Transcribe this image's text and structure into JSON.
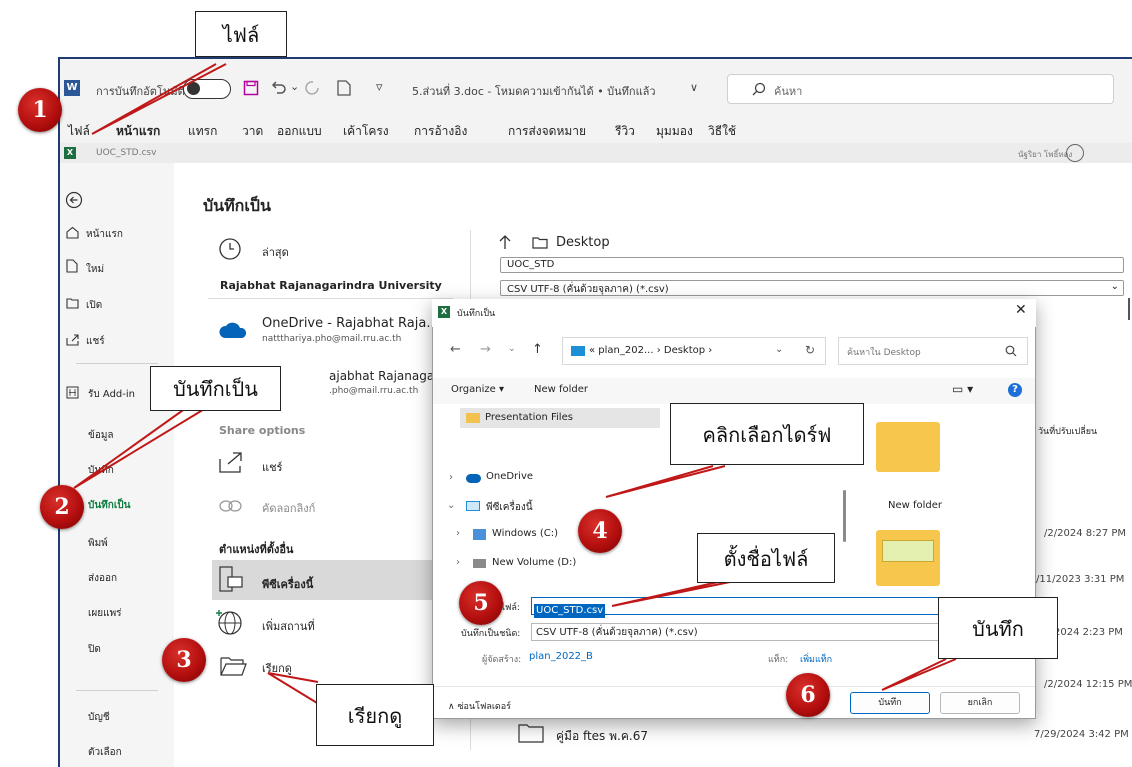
{
  "word": {
    "app_icon": "W",
    "autosave_label": "การบันทึกอัตโนมัติ",
    "doc_title": "5.ส่วนที่ 3.doc - โหมดความเข้ากันได้ • บันทึกแล้ว",
    "title_chevron": "∨",
    "undo_chevron": "⌄",
    "qat_more": "▿",
    "search_placeholder": "ค้นหา",
    "ribbon_tabs": [
      "ไฟล์",
      "หน้าแรก",
      "แทรก",
      "วาด",
      "ออกแบบ",
      "เค้าโครง",
      "การอ้างอิง",
      "การส่งจดหมาย",
      "รีวิว",
      "มุมมอง",
      "วิธีใช้"
    ]
  },
  "excel": {
    "icon": "X",
    "filename": "UOC_STD.csv",
    "user_name": "นัฐริยา โพธิ์ทอง"
  },
  "nav": {
    "items": [
      "หน้าแรก",
      "ใหม่",
      "เปิด",
      "แชร์",
      "รับ Add-in",
      "ข้อมูล",
      "บันทึก",
      "บันทึกเป็น",
      "พิมพ์",
      "ส่งออก",
      "เผยแพร่",
      "ปิด",
      "บัญชี",
      "ตัวเลือก"
    ]
  },
  "backstage": {
    "title": "บันทึกเป็น",
    "recent": "ล่าสุด",
    "university": "Rajabhat Rajanagarindra University",
    "onedrive_name": "OneDrive - Rajabhat Raja...",
    "onedrive_email": "nattthariya.pho@mail.rru.ac.th",
    "site_name": "ajabhat Rajanagar...",
    "site_email": ".pho@mail.rru.ac.th",
    "share_options": "Share options",
    "share": "แชร์",
    "copy_link": "คัดลอกลิงก์",
    "other_locations": "ตำแหน่งที่ตั้งอื่น",
    "this_pc": "พีซีเครื่องนี้",
    "add_place": "เพิ่มสถานที่",
    "browse": "เรียกดู",
    "breadcrumb": "Desktop",
    "name_field": "UOC_STD",
    "type_field": "CSV UTF-8 (คั่นด้วยจุลภาค) (*.csv)",
    "col_modified": "วันที่ปรับเปลี่ยน",
    "dates": [
      "/2/2024 8:27 PM",
      "/11/2023 3:31 PM",
      "2024 2:23 PM",
      "/2/2024 12:15 PM",
      "7/29/2024 3:42 PM"
    ],
    "last_folder": "คู่มือ ftes พ.ค.67"
  },
  "dialog": {
    "title": "บันทึกเป็น",
    "address": "« plan_202... › Desktop ›",
    "search_placeholder": "ค้นหาใน Desktop",
    "organize": "Organize ▾",
    "new_folder": "New folder",
    "tree": [
      "Presentation Files",
      "OneDrive",
      "พีซีเครื่องนี้",
      "Windows (C:)",
      "New Volume (D:)"
    ],
    "file_folder": "New folder",
    "filename_label": "ชื่อไฟล์:",
    "filename_value": "UOC_STD.csv",
    "filetype_label": "บันทึกเป็นชนิด:",
    "filetype_value": "CSV UTF-8 (คั่นด้วยจุลภาค) (*.csv)",
    "author_label": "ผู้จัดสร้าง:",
    "author_value": "plan_2022_B",
    "tags_label": "แท็ก:",
    "tags_value": "เพิ่มแท็ก",
    "hide_folders": "ซ่อนโฟลเดอร์",
    "save_btn": "บันทึก",
    "cancel_btn": "ยกเลิก"
  },
  "callouts": {
    "file": "ไฟล์",
    "save_as": "บันทึกเป็น",
    "choose_drive": "คลิกเลือกไดร์ฟ",
    "set_name": "ตั้งชื่อไฟล์",
    "save": "บันทึก",
    "browse": "เรียกดู"
  },
  "steps": [
    "1",
    "2",
    "3",
    "4",
    "5",
    "6"
  ]
}
